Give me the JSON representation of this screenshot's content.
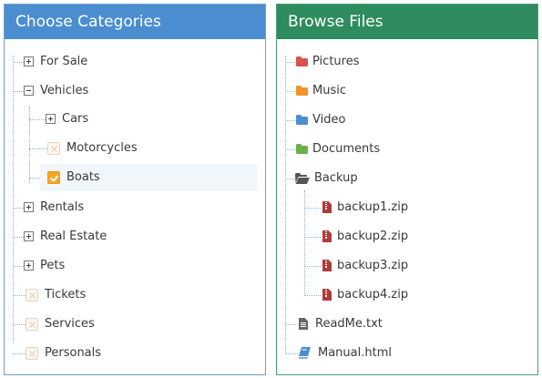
{
  "categories": {
    "title": "Choose Categories",
    "items": [
      {
        "label": "For Sale",
        "control": "plus"
      },
      {
        "label": "Vehicles",
        "control": "minus"
      },
      {
        "label": "Cars",
        "control": "plus"
      },
      {
        "label": "Motorcycles",
        "control": "checkbox",
        "checked": false
      },
      {
        "label": "Boats",
        "control": "checkbox",
        "checked": true
      },
      {
        "label": "Rentals",
        "control": "plus"
      },
      {
        "label": "Real Estate",
        "control": "plus"
      },
      {
        "label": "Pets",
        "control": "plus"
      },
      {
        "label": "Tickets",
        "control": "checkbox",
        "checked": false
      },
      {
        "label": "Services",
        "control": "checkbox",
        "checked": false
      },
      {
        "label": "Personals",
        "control": "checkbox",
        "checked": false
      }
    ]
  },
  "files": {
    "title": "Browse Files",
    "items": [
      {
        "label": "Pictures",
        "icon": "folder-icon",
        "color": "#d9534f"
      },
      {
        "label": "Music",
        "icon": "folder-icon",
        "color": "#f0932b"
      },
      {
        "label": "Video",
        "icon": "folder-icon",
        "color": "#4b8ed0"
      },
      {
        "label": "Documents",
        "icon": "folder-icon",
        "color": "#6ab04c"
      },
      {
        "label": "Backup",
        "icon": "folder-open-icon",
        "color": "#555555"
      },
      {
        "label": "backup1.zip",
        "icon": "zip-file-icon",
        "color": "#b03a3a"
      },
      {
        "label": "backup2.zip",
        "icon": "zip-file-icon",
        "color": "#b03a3a"
      },
      {
        "label": "backup3.zip",
        "icon": "zip-file-icon",
        "color": "#b03a3a"
      },
      {
        "label": "backup4.zip",
        "icon": "zip-file-icon",
        "color": "#b03a3a"
      },
      {
        "label": "ReadMe.txt",
        "icon": "text-file-icon",
        "color": "#666666"
      },
      {
        "label": "Manual.html",
        "icon": "book-icon",
        "color": "#4b8ed0"
      }
    ]
  },
  "colors": {
    "categories_header": "#4b8ed0",
    "files_header": "#2e8c5e",
    "checkbox_checked": "#f5a623",
    "selected_row": "#f1f6fa"
  }
}
